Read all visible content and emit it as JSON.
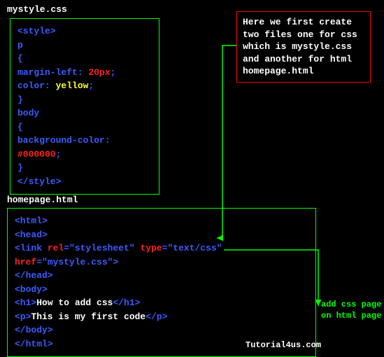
{
  "labels": {
    "file1": "mystyle.css",
    "file2": "homepage.html"
  },
  "note": "Here we first create two files one for css which is mystyle.css and another for html homepage.html",
  "css": {
    "open": "<style>",
    "sel_p": "p",
    "brace_open": "{",
    "prop1_name": "margin-left",
    "colon": ": ",
    "prop1_val": "20px",
    "semi": ";",
    "prop2_name": "color",
    "prop2_val": "yellow",
    "brace_close": "}",
    "sel_body": "body",
    "prop3_name": "background-color",
    "prop3_val": "#000000",
    "close": "</style>"
  },
  "html": {
    "open_html": "<html>",
    "open_head": "<head>",
    "link_tag": "<link ",
    "rel_attr": "rel",
    "eq": "=",
    "rel_val": "\"stylesheet\"",
    "sp": " ",
    "type_attr": "type",
    "type_val": "\"text/css\"",
    "href_attr": "href",
    "href_val": "\"mystyle.css\"",
    "tag_end": ">",
    "close_head": "</head>",
    "open_body": "<body>",
    "h1_open": "<h1>",
    "h1_text": "How to add css",
    "h1_close": "</h1>",
    "p_open": "<p>",
    "p_text": "This is my first code",
    "p_close": "</p>",
    "close_body": "</body>",
    "close_html": "</html>"
  },
  "arrow_label": {
    "l1": "add css page",
    "l2": "on html page"
  },
  "watermark": "Tutorial4us.com"
}
